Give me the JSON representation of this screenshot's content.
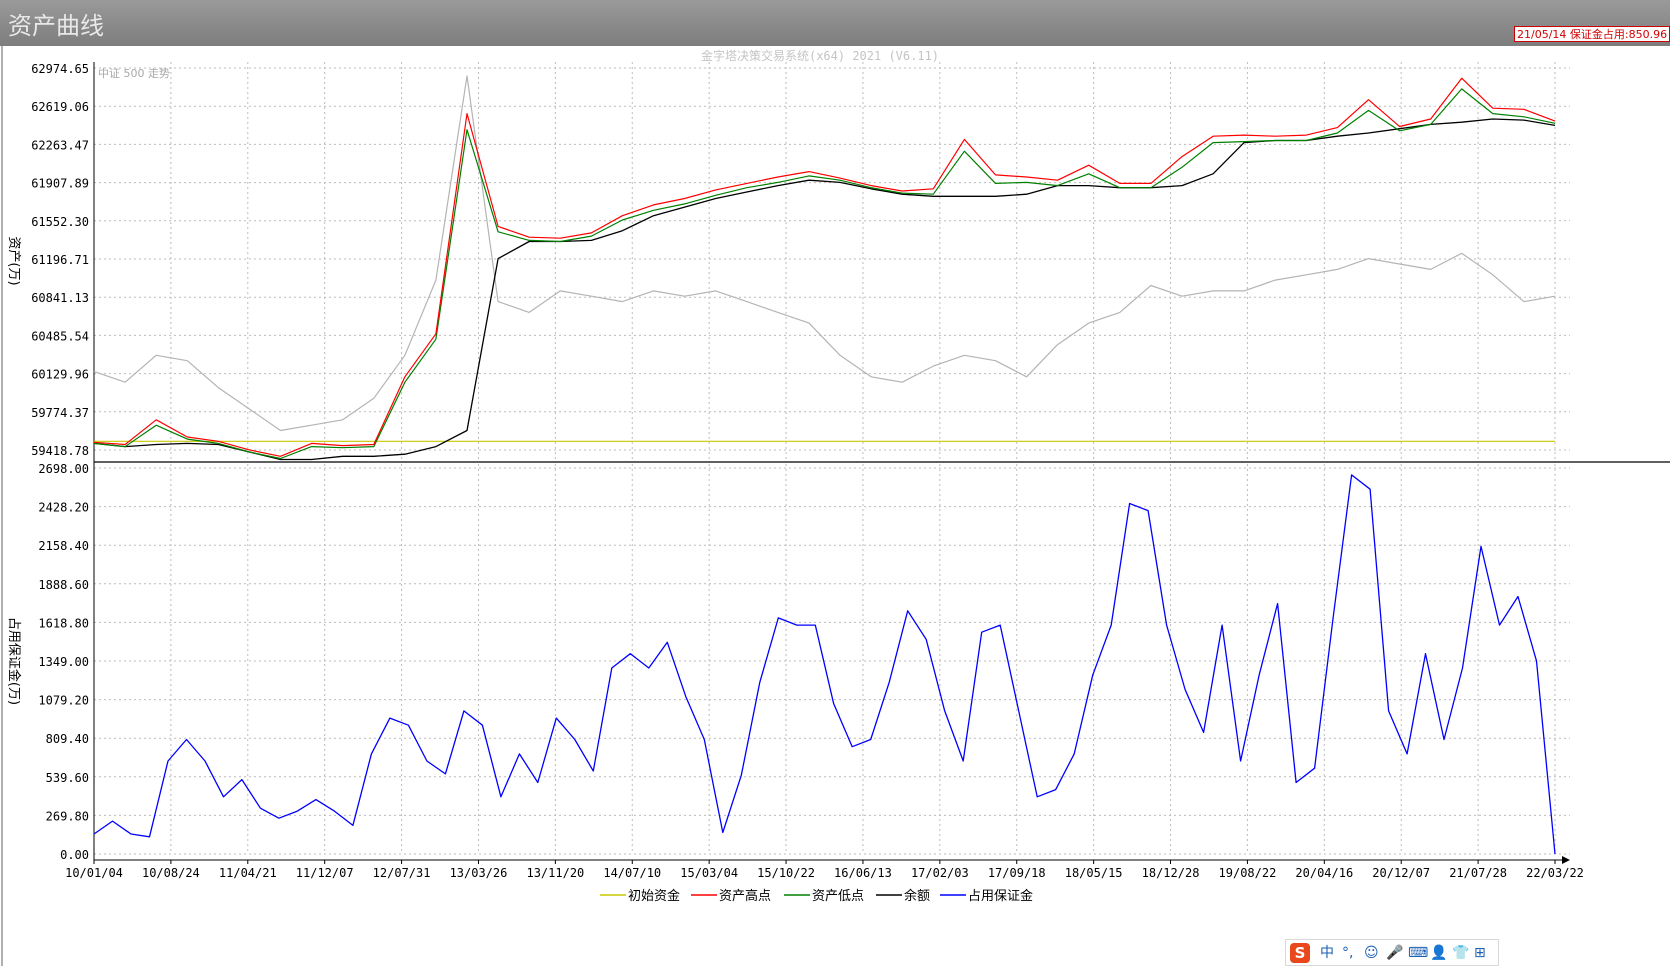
{
  "window": {
    "title": "资产曲线"
  },
  "status": {
    "text": "21/05/14 保证金占用:850.96"
  },
  "watermark": "金字塔决策交易系统(x64) 2021 (V6.11)",
  "colors": {
    "initial": "#c8c800",
    "high": "#ff0000",
    "low": "#008000",
    "balance": "#000000",
    "margin": "#0000ff",
    "index": "#b4b4b4",
    "grid": "#bcbcbc"
  },
  "ime_toolbar": {
    "logo": "S",
    "items": [
      "中",
      "°,",
      "☺",
      "🎤",
      "⌨",
      "👤",
      "👕",
      "⊞"
    ]
  },
  "chart_data": [
    {
      "type": "line",
      "title": "",
      "index_label": "中证 500 走势",
      "ylabel": "资产(万)",
      "ylim": [
        59418.78,
        62974.65
      ],
      "yticks": [
        "62974.65",
        "62619.06",
        "62263.47",
        "61907.89",
        "61552.30",
        "61196.71",
        "60841.13",
        "60485.54",
        "60129.96",
        "59774.37",
        "59418.78"
      ],
      "x_ticks": [
        "10/01/04",
        "10/08/24",
        "11/04/21",
        "11/12/07",
        "12/07/31",
        "13/03/26",
        "13/11/20",
        "14/07/10",
        "15/03/04",
        "15/10/22",
        "16/06/13",
        "17/02/03",
        "17/09/18",
        "18/05/15",
        "18/12/28",
        "19/08/22",
        "20/04/16",
        "20/12/07",
        "21/07/28",
        "22/03/22"
      ],
      "series": [
        {
          "name": "初始资金",
          "color": "#c8c800",
          "values": [
            59500,
            59500
          ]
        },
        {
          "name": "资产高点",
          "color": "#ff0000",
          "values": [
            59490,
            59470,
            59700,
            59540,
            59500,
            59420,
            59360,
            59480,
            59460,
            59470,
            60100,
            60500,
            62550,
            61500,
            61400,
            61390,
            61440,
            61600,
            61700,
            61760,
            61840,
            61900,
            61960,
            62010,
            61950,
            61880,
            61830,
            61850,
            62310,
            61980,
            61960,
            61930,
            62070,
            61900,
            61900,
            62150,
            62340,
            62350,
            62340,
            62350,
            62420,
            62680,
            62430,
            62500,
            62880,
            62600,
            62590,
            62480
          ]
        },
        {
          "name": "资产低点",
          "color": "#008000",
          "values": [
            59480,
            59450,
            59650,
            59520,
            59480,
            59400,
            59340,
            59450,
            59440,
            59450,
            60050,
            60450,
            62400,
            61450,
            61370,
            61360,
            61410,
            61560,
            61650,
            61710,
            61790,
            61860,
            61910,
            61970,
            61930,
            61860,
            61810,
            61800,
            62200,
            61900,
            61910,
            61880,
            61990,
            61860,
            61860,
            62050,
            62280,
            62290,
            62300,
            62300,
            62370,
            62580,
            62390,
            62450,
            62780,
            62550,
            62520,
            62460
          ]
        },
        {
          "name": "余额",
          "color": "#000000",
          "values": [
            59480,
            59450,
            59470,
            59480,
            59470,
            59400,
            59330,
            59330,
            59360,
            59360,
            59380,
            59450,
            59600,
            61200,
            61360,
            61360,
            61370,
            61460,
            61600,
            61680,
            61760,
            61820,
            61880,
            61930,
            61910,
            61850,
            61800,
            61780,
            61780,
            61780,
            61800,
            61880,
            61880,
            61860,
            61860,
            61880,
            61990,
            62280,
            62300,
            62300,
            62340,
            62370,
            62410,
            62450,
            62470,
            62500,
            62490,
            62440
          ]
        },
        {
          "name": "中证 500 走势",
          "color": "#b4b4b4",
          "values": [
            60150,
            60050,
            60300,
            60250,
            60000,
            59800,
            59600,
            59650,
            59700,
            59900,
            60300,
            61000,
            62900,
            60800,
            60700,
            60900,
            60850,
            60800,
            60900,
            60850,
            60900,
            60800,
            60700,
            60600,
            60300,
            60100,
            60050,
            60200,
            60300,
            60250,
            60100,
            60400,
            60600,
            60700,
            60950,
            60850,
            60900,
            60900,
            61000,
            61050,
            61100,
            61200,
            61150,
            61100,
            61250,
            61050,
            60800,
            60850
          ]
        }
      ]
    },
    {
      "type": "line",
      "title": "",
      "ylabel": "占用保证金(万)",
      "ylim": [
        0,
        2698
      ],
      "yticks": [
        "2698.00",
        "2428.20",
        "2158.40",
        "1888.60",
        "1618.80",
        "1349.00",
        "1079.20",
        "809.40",
        "539.60",
        "269.80",
        "0.00"
      ],
      "x_ticks": [
        "10/01/04",
        "10/08/24",
        "11/04/21",
        "11/12/07",
        "12/07/31",
        "13/03/26",
        "13/11/20",
        "14/07/10",
        "15/03/04",
        "15/10/22",
        "16/06/13",
        "17/02/03",
        "17/09/18",
        "18/05/15",
        "18/12/28",
        "19/08/22",
        "20/04/16",
        "20/12/07",
        "21/07/28",
        "22/03/22"
      ],
      "series": [
        {
          "name": "占用保证金",
          "color": "#0000ff",
          "values": [
            140,
            230,
            140,
            120,
            650,
            800,
            650,
            400,
            520,
            320,
            250,
            300,
            380,
            300,
            200,
            700,
            950,
            900,
            650,
            560,
            1000,
            900,
            400,
            700,
            500,
            950,
            800,
            580,
            1300,
            1400,
            1300,
            1480,
            1100,
            800,
            150,
            550,
            1200,
            1650,
            1600,
            1600,
            1050,
            750,
            800,
            1200,
            1700,
            1500,
            1000,
            650,
            1550,
            1600,
            1000,
            400,
            450,
            700,
            1250,
            1600,
            2450,
            2400,
            1600,
            1150,
            850,
            1600,
            650,
            1250,
            1750,
            500,
            600,
            1650,
            2650,
            2550,
            1000,
            700,
            1400,
            800,
            1300,
            2150,
            1600,
            1800,
            1350,
            0
          ]
        }
      ]
    }
  ]
}
